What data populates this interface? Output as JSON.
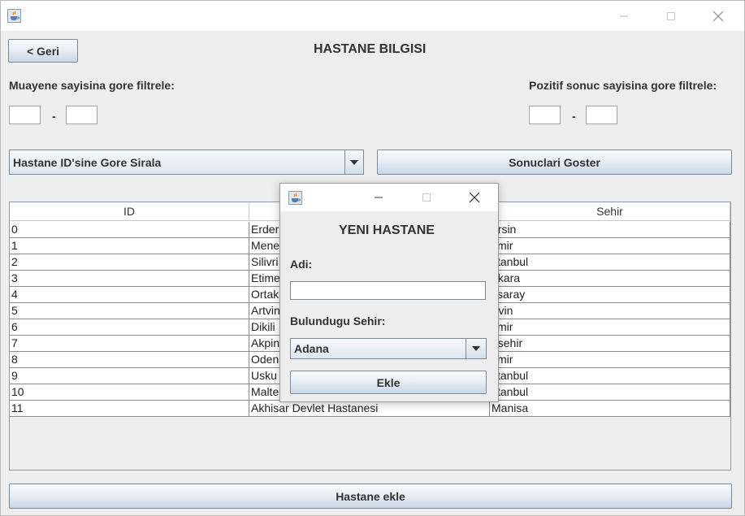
{
  "window": {
    "icon": "java-cup-icon",
    "controls": [
      "minimize-icon",
      "maximize-icon",
      "close-icon"
    ]
  },
  "header": {
    "back_label": "< Geri",
    "title": "HASTANE BILGISI"
  },
  "filters": {
    "examination_label": "Muayene sayisina gore filtrele:",
    "examination_min": "",
    "examination_max": "",
    "positive_label": "Pozitif sonuc sayisina gore filtrele:",
    "positive_min": "",
    "positive_max": "",
    "dash": "-"
  },
  "sort": {
    "selected": "Hastane ID'sine Gore Sirala",
    "show_results_label": "Sonuclari Goster"
  },
  "table": {
    "headers": [
      "ID",
      "",
      "Sehir"
    ],
    "rows": [
      {
        "id": "0",
        "name": "Erder",
        "city": "ersin"
      },
      {
        "id": "1",
        "name": "Mene",
        "city": "zmir"
      },
      {
        "id": "2",
        "name": "Silivri",
        "city": "stanbul"
      },
      {
        "id": "3",
        "name": "Etime",
        "city": "nkara"
      },
      {
        "id": "4",
        "name": "Ortak",
        "city": "ksaray"
      },
      {
        "id": "5",
        "name": "Artvin",
        "city": "rtvin"
      },
      {
        "id": "6",
        "name": "Dikili",
        "city": "zmir"
      },
      {
        "id": "7",
        "name": "Akpin",
        "city": "irsehir"
      },
      {
        "id": "8",
        "name": "Oden",
        "city": "zmir"
      },
      {
        "id": "9",
        "name": "Usku",
        "city": "stanbul"
      },
      {
        "id": "10",
        "name": "Malte",
        "city": "stanbul"
      },
      {
        "id": "11",
        "name": "Akhisar Devlet Hastanesi",
        "city": "Manisa"
      }
    ]
  },
  "footer": {
    "add_hospital_label": "Hastane ekle"
  },
  "dialog": {
    "title": "YENI HASTANE",
    "name_label": "Adi:",
    "name_value": "",
    "city_label": "Bulundugu Sehir:",
    "city_selected": "Adana",
    "add_label": "Ekle"
  },
  "colors": {
    "window_bg": "#eeeeee",
    "button_border": "#7a8a99",
    "text": "#333333"
  }
}
